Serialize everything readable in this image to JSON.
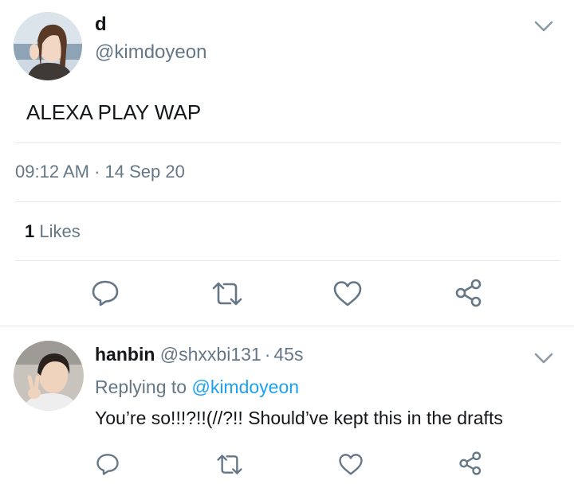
{
  "tweet": {
    "display_name": "d",
    "handle": "@kimdoyeon",
    "text": "ALEXA PLAY WAP",
    "time": "09:12 AM",
    "separator": "·",
    "date": "14 Sep 20",
    "likes_count": "1",
    "likes_label": "Likes",
    "actions": [
      "reply-icon",
      "retweet-icon",
      "like-icon",
      "share-icon"
    ]
  },
  "reply": {
    "display_name": "hanbin",
    "handle": "@shxxbi131",
    "separator": "·",
    "time_ago": "45s",
    "replying_prefix": "Replying to",
    "replying_handle": "@kimdoyeon",
    "text": "You’re so!!!?!!(//?!! Should’ve kept this in the drafts",
    "actions": [
      "reply-icon",
      "retweet-icon",
      "like-icon",
      "share-icon"
    ]
  },
  "colors": {
    "icon_gray": "#657786",
    "link_blue": "#1da1f2",
    "divider": "#e1e8ed"
  }
}
